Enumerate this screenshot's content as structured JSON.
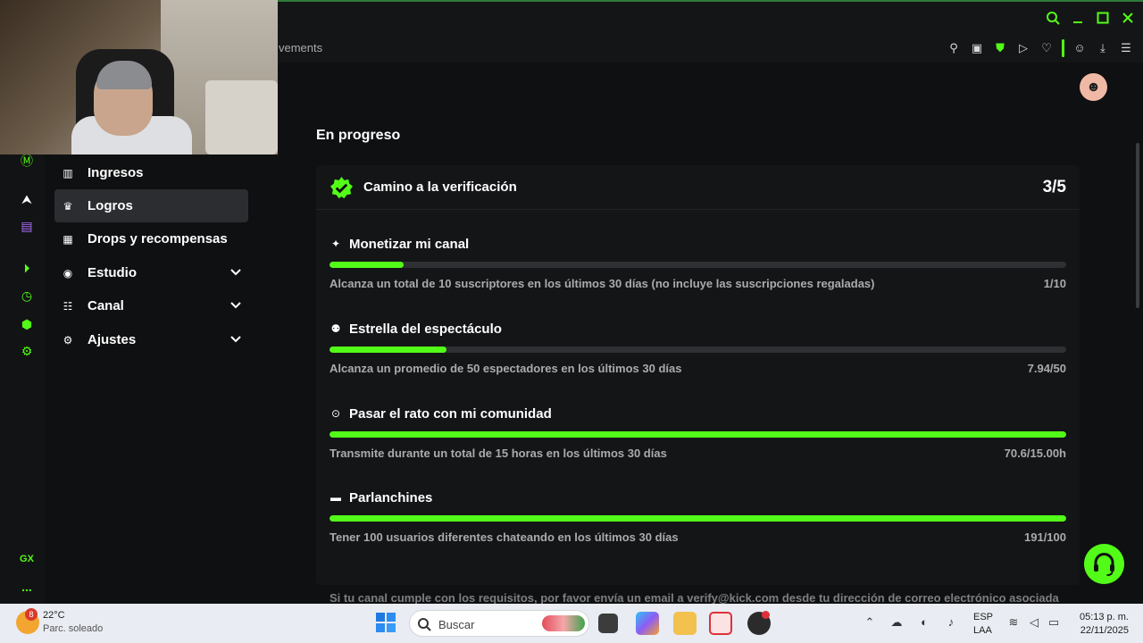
{
  "browser": {
    "breadcrumb": "vements",
    "window_controls": [
      "search-icon",
      "minimize-icon",
      "maximize-icon",
      "close-icon"
    ],
    "toolbar_icons": [
      "pin-icon",
      "snapshot-icon",
      "shield-icon",
      "play-icon",
      "heart-icon",
      "account-icon",
      "download-icon",
      "menu-icon"
    ]
  },
  "gx_sidebar": {
    "icons": [
      "kick-icon",
      "arrow-icon",
      "twitch-icon",
      "player-icon",
      "history-icon",
      "extensions-icon",
      "settings-icon"
    ],
    "gx_label": "GX",
    "more": "..."
  },
  "sidebar": {
    "items": [
      {
        "label": "Ingresos",
        "icon": "chart-icon",
        "active": false,
        "expandable": false
      },
      {
        "label": "Logros",
        "icon": "trophy-icon",
        "active": true,
        "expandable": false
      },
      {
        "label": "Drops y recompensas",
        "icon": "gift-icon",
        "active": false,
        "expandable": false
      },
      {
        "label": "Estudio",
        "icon": "studio-icon",
        "active": false,
        "expandable": true
      },
      {
        "label": "Canal",
        "icon": "channel-icon",
        "active": false,
        "expandable": true
      },
      {
        "label": "Ajustes",
        "icon": "gear-icon",
        "active": false,
        "expandable": true
      }
    ]
  },
  "main": {
    "section_title": "En progreso",
    "card": {
      "title": "Camino a la verificación",
      "count": "3/5",
      "goals": [
        {
          "title": "Monetizar mi canal",
          "icon": "sparkle-icon",
          "progress": 0.1,
          "description": "Alcanza un total de 10 suscriptores en los últimos 30 días (no incluye las suscripciones regaladas)",
          "value": "1/10"
        },
        {
          "title": "Estrella del espectáculo",
          "icon": "viewers-icon",
          "progress": 0.159,
          "description": "Alcanza un promedio de 50 espectadores en los últimos 30 días",
          "value": "7.94/50"
        },
        {
          "title": "Pasar el rato con mi comunidad",
          "icon": "broadcast-icon",
          "progress": 1.0,
          "description": "Transmite durante un total de 15 horas en los últimos 30 días",
          "value": "70.6/15.00h"
        },
        {
          "title": "Parlanchines",
          "icon": "chat-icon",
          "progress": 1.0,
          "description": "Tener 100 usuarios diferentes chateando en los últimos 30 días",
          "value": "191/100"
        }
      ]
    },
    "footnote": "Si tu canal cumple con los requisitos, por favor envía un email a verify@kick.com desde tu dirección de correo electrónico asociada"
  },
  "taskbar": {
    "weather_badge": "8",
    "temperature": "22°C",
    "condition": "Parc. soleado",
    "search_placeholder": "Buscar",
    "language": "ESP",
    "layout": "LAA",
    "time": "05:13 p. m.",
    "date": "22/11/2025"
  },
  "colors": {
    "accent": "#53fc18",
    "background": "#0f1011",
    "card": "#141517",
    "muted_text": "#a9abad"
  }
}
